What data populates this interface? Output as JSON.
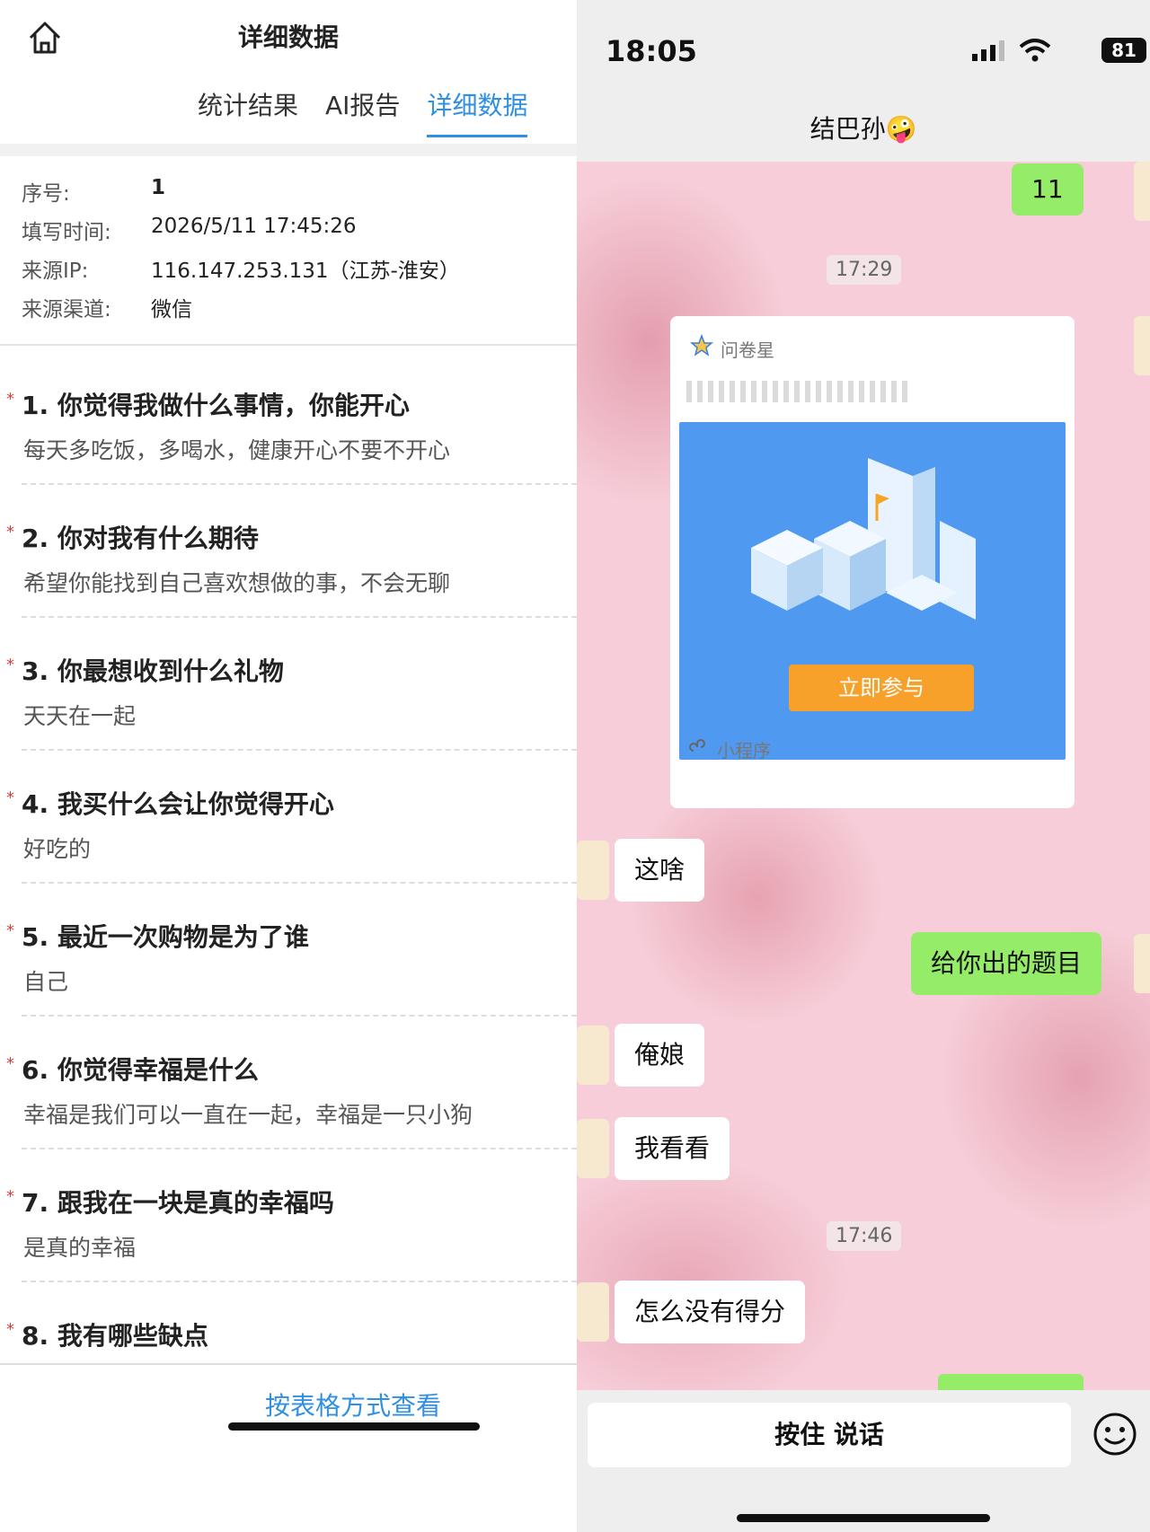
{
  "left": {
    "title": "详细数据",
    "tabs": [
      "统计结果",
      "AI报告",
      "详细数据"
    ],
    "meta": [
      {
        "label": "序号:",
        "value": "1"
      },
      {
        "label": "填写时间:",
        "value": "2026/5/11 17:45:26"
      },
      {
        "label": "来源IP:",
        "value": "116.147.253.131（江苏-淮安）"
      },
      {
        "label": "来源渠道:",
        "value": "微信"
      }
    ],
    "questions": [
      {
        "title": "1. 你觉得我做什么事情，你能开心",
        "answer": "每天多吃饭，多喝水，健康开心不要不开心"
      },
      {
        "title": "2. 你对我有什么期待",
        "answer": "希望你能找到自己喜欢想做的事，不会无聊"
      },
      {
        "title": "3. 你最想收到什么礼物",
        "answer": "天天在一起"
      },
      {
        "title": "4. 我买什么会让你觉得开心",
        "answer": "好吃的"
      },
      {
        "title": "5. 最近一次购物是为了谁",
        "answer": "自己"
      },
      {
        "title": "6. 你觉得幸福是什么",
        "answer": "幸福是我们可以一直在一起，幸福是一只小狗"
      },
      {
        "title": "7. 跟我在一块是真的幸福吗",
        "answer": "是真的幸福"
      },
      {
        "title": "8. 我有哪些缺点",
        "answer": ""
      }
    ],
    "required_mark": "*",
    "table_view_link": "按表格方式查看"
  },
  "right": {
    "status_time": "18:05",
    "battery": "81",
    "chat_name": "结巴孙🤪",
    "messages": {
      "m1": "11",
      "ts1": "17:29",
      "card_source": "问卷星",
      "card_button": "立即参与",
      "card_type": "小程序",
      "m2": "这啥",
      "m3": "给你出的题目",
      "m4": "俺娘",
      "m5": "我看看",
      "ts2": "17:46",
      "m6": "怎么没有得分"
    },
    "talk_button": "按住 说话"
  }
}
